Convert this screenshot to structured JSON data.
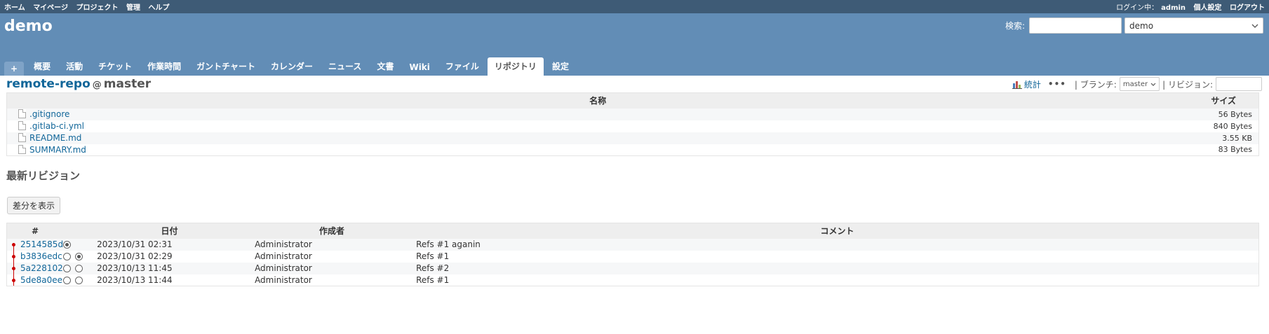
{
  "top_menu": {
    "left": [
      "ホーム",
      "マイページ",
      "プロジェクト",
      "管理",
      "ヘルプ"
    ],
    "login_label": "ログイン中：",
    "user": "admin",
    "my_account": "個人設定",
    "logout": "ログアウト"
  },
  "header": {
    "project_title": "demo",
    "search_label": "検索:",
    "search_value": "",
    "project_jump": "demo"
  },
  "main_menu": {
    "new_label": "+",
    "tabs": [
      "概要",
      "活動",
      "チケット",
      "作業時間",
      "ガントチャート",
      "カレンダー",
      "ニュース",
      "文書",
      "Wiki",
      "ファイル",
      "リポジトリ",
      "設定"
    ],
    "selected": "リポジトリ"
  },
  "repository": {
    "name": "remote-repo",
    "at": "@",
    "branch_title": "master",
    "stats_label": "統計",
    "more": "•••",
    "branch_label": "| ブランチ:",
    "branch_value": "master",
    "revision_label": "| リビジョン:",
    "revision_value": ""
  },
  "entries": {
    "headers": {
      "name": "名称",
      "size": "サイズ"
    },
    "rows": [
      {
        "name": ".gitignore",
        "size": "56 Bytes"
      },
      {
        "name": ".gitlab-ci.yml",
        "size": "840 Bytes"
      },
      {
        "name": "README.md",
        "size": "3.55 KB"
      },
      {
        "name": "SUMMARY.md",
        "size": "83 Bytes"
      }
    ]
  },
  "latest": {
    "heading": "最新リビジョン",
    "show_diff": "差分を表示",
    "headers": {
      "rev": "#",
      "date": "日付",
      "author": "作成者",
      "comment": "コメント"
    },
    "rows": [
      {
        "rev": "2514585d",
        "date": "2023/10/31 02:31",
        "author": "Administrator",
        "comment": "Refs #1 aganin",
        "radio1": "checked",
        "radio2": "none"
      },
      {
        "rev": "b3836edc",
        "date": "2023/10/31 02:29",
        "author": "Administrator",
        "comment": "Refs #1",
        "radio1": "empty",
        "radio2": "checked"
      },
      {
        "rev": "5a228102",
        "date": "2023/10/13 11:45",
        "author": "Administrator",
        "comment": "Refs #2",
        "radio1": "empty",
        "radio2": "empty"
      },
      {
        "rev": "5de8a0ee",
        "date": "2023/10/13 11:44",
        "author": "Administrator",
        "comment": "Refs #1",
        "radio1": "empty",
        "radio2": "empty"
      }
    ]
  },
  "colors": {
    "top_menu_bg": "#3e5b76",
    "header_bg": "#628db6",
    "link": "#116699",
    "graph": "#cc0000"
  }
}
